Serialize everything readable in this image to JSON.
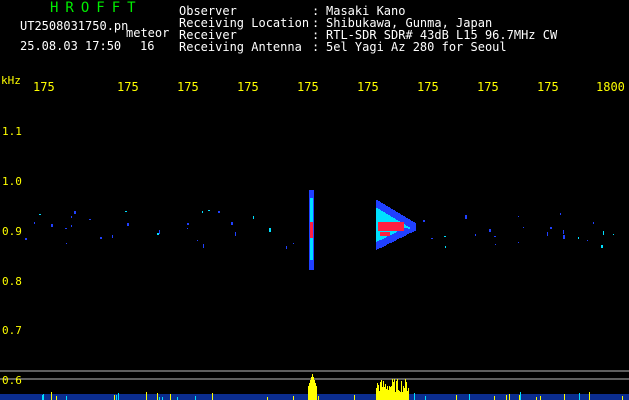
{
  "header": {
    "logo": "HROFFT",
    "filename": "UT2508031750.pn",
    "meteor_label": "meteor",
    "datetime": "25.08.03 17:50",
    "count": "16",
    "info": [
      {
        "label": "Observer",
        "value": "Masaki Kano"
      },
      {
        "label": "Receiving Location",
        "value": "Shibukawa, Gunma, Japan"
      },
      {
        "label": "Receiver",
        "value": "RTL-SDR SDR# 43dB L15 96.7MHz CW"
      },
      {
        "label": "Receiving Antenna",
        "value": "5el Yagi Az 280 for Seoul"
      }
    ]
  },
  "axes": {
    "x_unit": "kHz",
    "x_ticks": [
      "175",
      "175",
      "175",
      "175",
      "175",
      "175",
      "175",
      "175",
      "175",
      "1800"
    ],
    "y_ticks": [
      "1.1",
      "1.0",
      "0.9",
      "0.8",
      "0.7",
      "0.6"
    ]
  },
  "colors": {
    "text_green": "#00ee00",
    "axis_yellow": "#ffff00",
    "echo_red": "#ff2040",
    "echo_cyan": "#00e0ff",
    "echo_blue": "#2040ff",
    "activity_yellow": "#ffff00"
  }
}
